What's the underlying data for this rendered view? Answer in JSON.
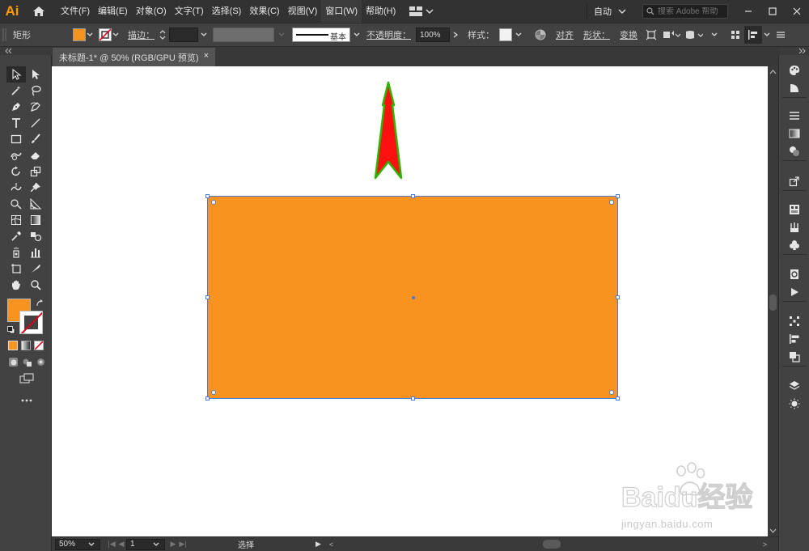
{
  "app": {
    "logo_text": "Ai",
    "menus": [
      "文件(F)",
      "编辑(E)",
      "对象(O)",
      "文字(T)",
      "选择(S)",
      "效果(C)",
      "视图(V)",
      "窗口(W)",
      "帮助(H)"
    ],
    "workspace": "自动",
    "help_search_placeholder": "搜索 Adobe 帮助"
  },
  "control_bar": {
    "object_type": "矩形",
    "stroke_label": "描边：",
    "stroke_profile": "基本",
    "opacity_label": "不透明度：",
    "opacity_value": "100%",
    "style_label": "样式：",
    "align_label": "对齐",
    "shape_label": "形状：",
    "transform_label": "变换"
  },
  "document": {
    "tab_title": "未标题-1* @ 50% (RGB/GPU 预览)",
    "close_glyph": "×"
  },
  "colors": {
    "fill": "#f7931e",
    "accent": "#ff9a00",
    "annotation_arrow": "#ff0000",
    "annotation_outline": "#2db400"
  },
  "status": {
    "zoom": "50%",
    "artboard": "1",
    "tool_status": "选择"
  },
  "watermark": {
    "brand": "Baidu经验",
    "url": "jingyan.baidu.com"
  }
}
